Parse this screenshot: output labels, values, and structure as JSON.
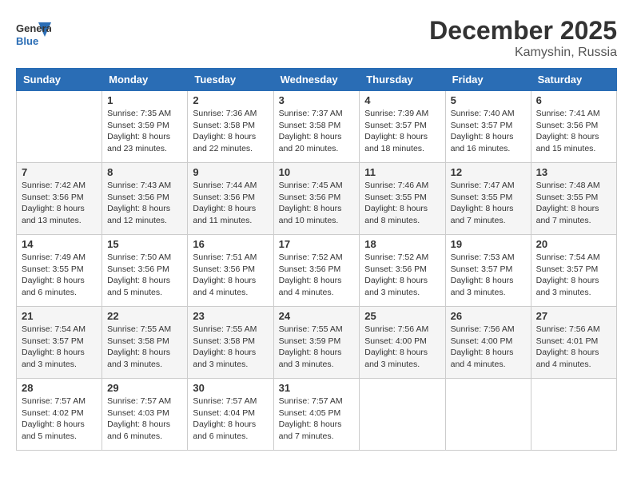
{
  "header": {
    "logo_general": "General",
    "logo_blue": "Blue",
    "month": "December 2025",
    "location": "Kamyshin, Russia"
  },
  "days_of_week": [
    "Sunday",
    "Monday",
    "Tuesday",
    "Wednesday",
    "Thursday",
    "Friday",
    "Saturday"
  ],
  "weeks": [
    [
      {
        "day": "",
        "info": ""
      },
      {
        "day": "1",
        "info": "Sunrise: 7:35 AM\nSunset: 3:59 PM\nDaylight: 8 hours\nand 23 minutes."
      },
      {
        "day": "2",
        "info": "Sunrise: 7:36 AM\nSunset: 3:58 PM\nDaylight: 8 hours\nand 22 minutes."
      },
      {
        "day": "3",
        "info": "Sunrise: 7:37 AM\nSunset: 3:58 PM\nDaylight: 8 hours\nand 20 minutes."
      },
      {
        "day": "4",
        "info": "Sunrise: 7:39 AM\nSunset: 3:57 PM\nDaylight: 8 hours\nand 18 minutes."
      },
      {
        "day": "5",
        "info": "Sunrise: 7:40 AM\nSunset: 3:57 PM\nDaylight: 8 hours\nand 16 minutes."
      },
      {
        "day": "6",
        "info": "Sunrise: 7:41 AM\nSunset: 3:56 PM\nDaylight: 8 hours\nand 15 minutes."
      }
    ],
    [
      {
        "day": "7",
        "info": "Sunrise: 7:42 AM\nSunset: 3:56 PM\nDaylight: 8 hours\nand 13 minutes."
      },
      {
        "day": "8",
        "info": "Sunrise: 7:43 AM\nSunset: 3:56 PM\nDaylight: 8 hours\nand 12 minutes."
      },
      {
        "day": "9",
        "info": "Sunrise: 7:44 AM\nSunset: 3:56 PM\nDaylight: 8 hours\nand 11 minutes."
      },
      {
        "day": "10",
        "info": "Sunrise: 7:45 AM\nSunset: 3:56 PM\nDaylight: 8 hours\nand 10 minutes."
      },
      {
        "day": "11",
        "info": "Sunrise: 7:46 AM\nSunset: 3:55 PM\nDaylight: 8 hours\nand 8 minutes."
      },
      {
        "day": "12",
        "info": "Sunrise: 7:47 AM\nSunset: 3:55 PM\nDaylight: 8 hours\nand 7 minutes."
      },
      {
        "day": "13",
        "info": "Sunrise: 7:48 AM\nSunset: 3:55 PM\nDaylight: 8 hours\nand 7 minutes."
      }
    ],
    [
      {
        "day": "14",
        "info": "Sunrise: 7:49 AM\nSunset: 3:55 PM\nDaylight: 8 hours\nand 6 minutes."
      },
      {
        "day": "15",
        "info": "Sunrise: 7:50 AM\nSunset: 3:56 PM\nDaylight: 8 hours\nand 5 minutes."
      },
      {
        "day": "16",
        "info": "Sunrise: 7:51 AM\nSunset: 3:56 PM\nDaylight: 8 hours\nand 4 minutes."
      },
      {
        "day": "17",
        "info": "Sunrise: 7:52 AM\nSunset: 3:56 PM\nDaylight: 8 hours\nand 4 minutes."
      },
      {
        "day": "18",
        "info": "Sunrise: 7:52 AM\nSunset: 3:56 PM\nDaylight: 8 hours\nand 3 minutes."
      },
      {
        "day": "19",
        "info": "Sunrise: 7:53 AM\nSunset: 3:57 PM\nDaylight: 8 hours\nand 3 minutes."
      },
      {
        "day": "20",
        "info": "Sunrise: 7:54 AM\nSunset: 3:57 PM\nDaylight: 8 hours\nand 3 minutes."
      }
    ],
    [
      {
        "day": "21",
        "info": "Sunrise: 7:54 AM\nSunset: 3:57 PM\nDaylight: 8 hours\nand 3 minutes."
      },
      {
        "day": "22",
        "info": "Sunrise: 7:55 AM\nSunset: 3:58 PM\nDaylight: 8 hours\nand 3 minutes."
      },
      {
        "day": "23",
        "info": "Sunrise: 7:55 AM\nSunset: 3:58 PM\nDaylight: 8 hours\nand 3 minutes."
      },
      {
        "day": "24",
        "info": "Sunrise: 7:55 AM\nSunset: 3:59 PM\nDaylight: 8 hours\nand 3 minutes."
      },
      {
        "day": "25",
        "info": "Sunrise: 7:56 AM\nSunset: 4:00 PM\nDaylight: 8 hours\nand 3 minutes."
      },
      {
        "day": "26",
        "info": "Sunrise: 7:56 AM\nSunset: 4:00 PM\nDaylight: 8 hours\nand 4 minutes."
      },
      {
        "day": "27",
        "info": "Sunrise: 7:56 AM\nSunset: 4:01 PM\nDaylight: 8 hours\nand 4 minutes."
      }
    ],
    [
      {
        "day": "28",
        "info": "Sunrise: 7:57 AM\nSunset: 4:02 PM\nDaylight: 8 hours\nand 5 minutes."
      },
      {
        "day": "29",
        "info": "Sunrise: 7:57 AM\nSunset: 4:03 PM\nDaylight: 8 hours\nand 6 minutes."
      },
      {
        "day": "30",
        "info": "Sunrise: 7:57 AM\nSunset: 4:04 PM\nDaylight: 8 hours\nand 6 minutes."
      },
      {
        "day": "31",
        "info": "Sunrise: 7:57 AM\nSunset: 4:05 PM\nDaylight: 8 hours\nand 7 minutes."
      },
      {
        "day": "",
        "info": ""
      },
      {
        "day": "",
        "info": ""
      },
      {
        "day": "",
        "info": ""
      }
    ]
  ]
}
